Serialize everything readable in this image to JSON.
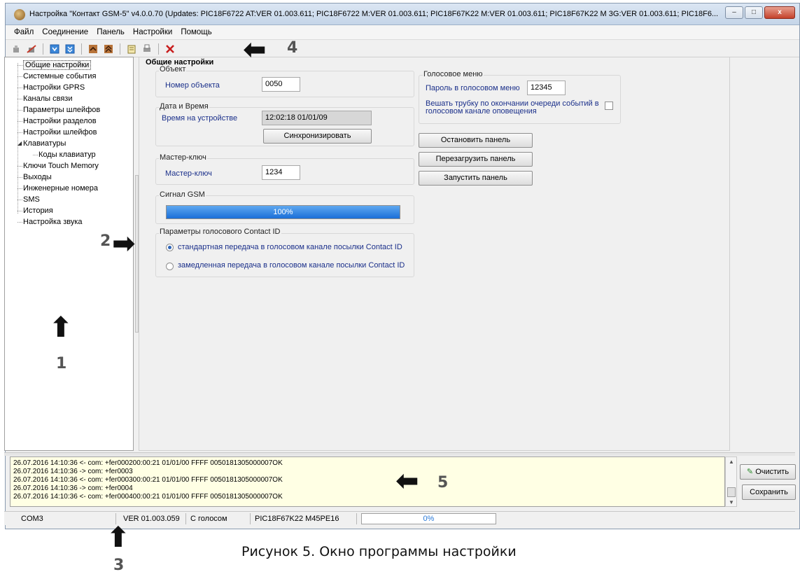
{
  "window": {
    "title": "Настройка \"Контакт GSM-5\" v4.0.0.70 (Updates: PIC18F6722 AT:VER 01.003.611; PIC18F6722 M:VER 01.003.611; PIC18F67K22 M:VER 01.003.611; PIC18F67K22 M 3G:VER 01.003.611; PIC18F6...",
    "minimize": "–",
    "maximize": "□",
    "close": "x"
  },
  "menu": [
    "Файл",
    "Соединение",
    "Панель",
    "Настройки",
    "Помощь"
  ],
  "toolbar": {
    "icons": [
      "connect-icon",
      "disconnect-icon",
      "read-icon",
      "write-icon",
      "up-icon",
      "down-icon",
      "copy-icon",
      "print-icon",
      "delete-icon"
    ]
  },
  "tree": {
    "items": [
      "Общие настройки",
      "Системные события",
      "Настройки GPRS",
      "Каналы связи",
      "Параметры шлейфов",
      "Настройки разделов",
      "Настройки шлейфов",
      "Клавиатуры",
      "Коды клавиатур",
      "Ключи Touch Memory",
      "Выходы",
      "Инженерные номера",
      "SMS",
      "История",
      "Настройка звука"
    ]
  },
  "panel": {
    "title": "Общие настройки",
    "object_group": "Объект",
    "object_label": "Номер объекта",
    "object_value": "0050",
    "datetime_group": "Дата и Время",
    "device_time_label": "Время на устройстве",
    "device_time_value": "12:02:18 01/01/09",
    "sync_button": "Синхронизировать",
    "master_group": "Мастер-ключ",
    "master_label": "Мастер-ключ",
    "master_value": "1234",
    "gsm_group": "Сигнал GSM",
    "gsm_level": 1.0,
    "gsm_text": "100%",
    "cid_group": "Параметры голосового Contact ID",
    "cid_standard": "стандартная передача в голосовом канале посылки Contact ID",
    "cid_slow": "замедленная передача в голосовом канале посылки Contact ID",
    "voice_group": "Голосовое меню",
    "voice_pw_label": "Пароль в голосовом меню",
    "voice_pw_value": "12345",
    "hangup_label_1": "Вешать трубку по окончании очереди событий в",
    "hangup_label_2": "голосовом канале оповещения",
    "stop_button": "Остановить панель",
    "restart_button": "Перезагрузить панель",
    "start_button": "Запустить панель"
  },
  "log": {
    "lines": [
      "26.07.2016 14:10:36 <- com:  +fer000200:00:21 01/01/00 FFFF 0050181305000007OK",
      "26.07.2016 14:10:36 -> com:  +fer0003",
      "26.07.2016 14:10:36 <- com:  +fer000300:00:21 01/01/00 FFFF 0050181305000007OK",
      "26.07.2016 14:10:36 -> com:  +fer0004",
      "26.07.2016 14:10:36 <- com:  +fer000400:00:21 01/01/00 FFFF 0050181305000007OK"
    ],
    "clear_button": "Очистить",
    "save_button": "Сохранить"
  },
  "status": {
    "port": "COM3",
    "version": "VER 01.003.059",
    "voice": "С голосом",
    "model": "PIC18F67K22 M45PE16",
    "progress": "0%"
  },
  "callouts": {
    "n1": "1",
    "n2": "2",
    "n3": "3",
    "n4": "4",
    "n5": "5"
  },
  "caption": "Рисунок 5.  Окно программы настройки"
}
